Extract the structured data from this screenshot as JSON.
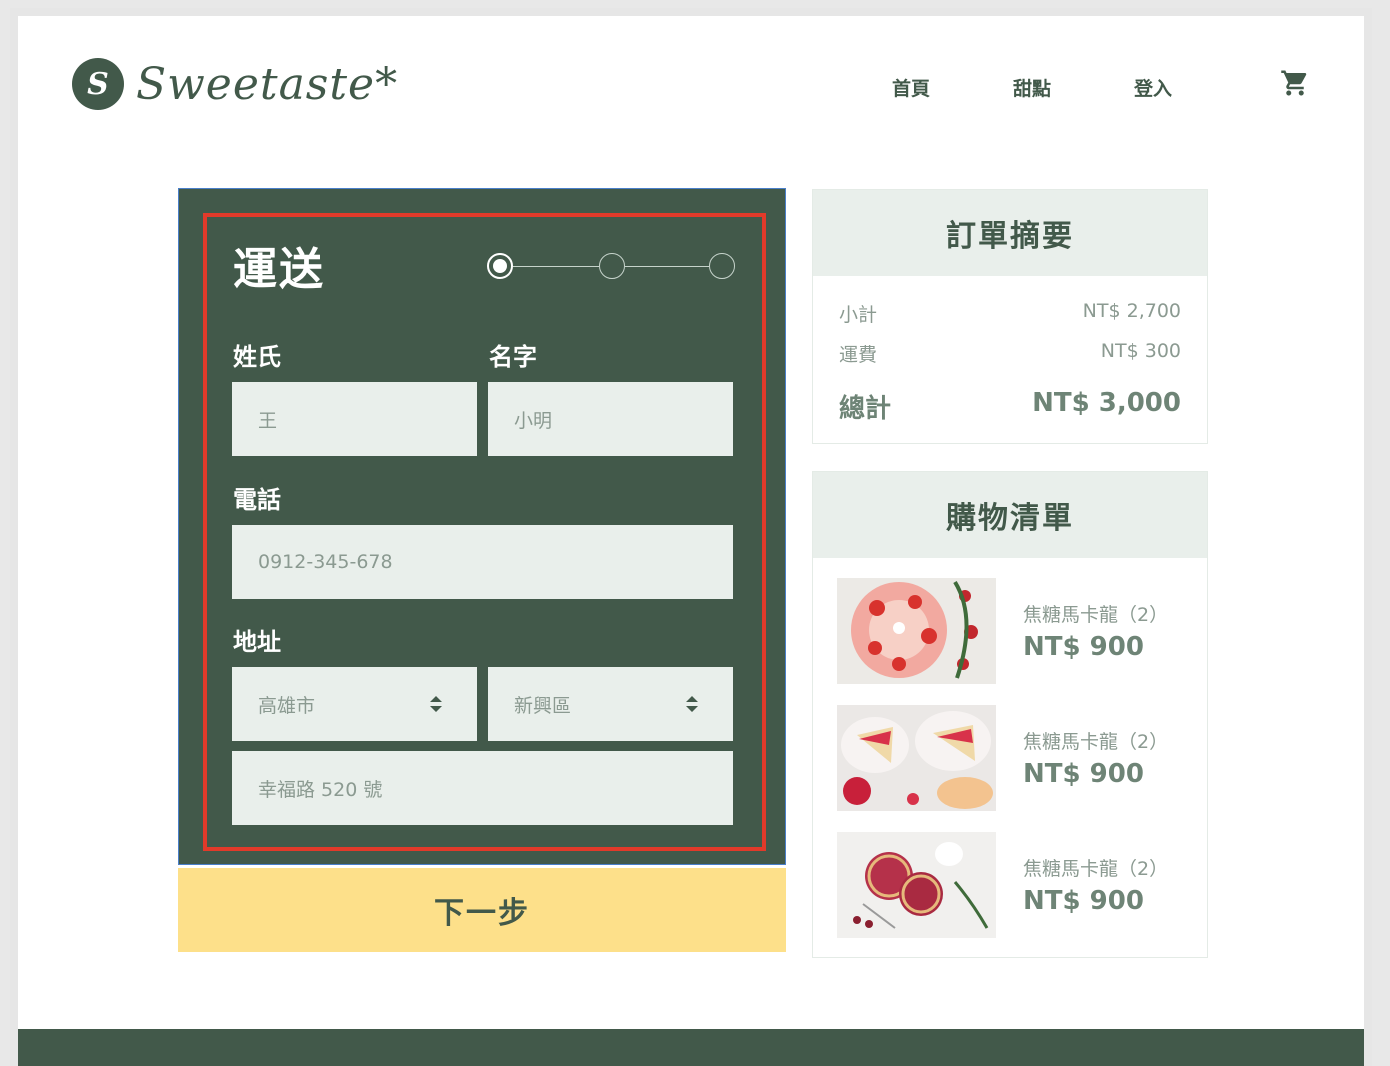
{
  "brand": {
    "logo_letter": "S",
    "name": "Sweetaste*"
  },
  "nav": {
    "items": [
      "首頁",
      "甜點",
      "登入"
    ],
    "cart_icon": "cart-icon"
  },
  "shipping": {
    "title": "運送",
    "steps": {
      "total": 3,
      "current": 1
    },
    "labels": {
      "last_name": "姓氏",
      "first_name": "名字",
      "phone": "電話",
      "address": "地址"
    },
    "values": {
      "last_name": "王",
      "first_name": "小明",
      "phone": "0912-345-678",
      "city": "高雄市",
      "district": "新興區",
      "street": "幸福路 520 號"
    },
    "next_label": "下一步"
  },
  "summary": {
    "title": "訂單摘要",
    "rows": [
      {
        "label": "小計",
        "value": "NT$ 2,700"
      },
      {
        "label": "運費",
        "value": "NT$ 300"
      }
    ],
    "total": {
      "label": "總計",
      "value": "NT$ 3,000"
    }
  },
  "cart": {
    "title": "購物清單",
    "items": [
      {
        "name": "焦糖馬卡龍（2）",
        "price": "NT$ 900"
      },
      {
        "name": "焦糖馬卡龍（2）",
        "price": "NT$ 900"
      },
      {
        "name": "焦糖馬卡龍（2）",
        "price": "NT$ 900"
      }
    ]
  },
  "colors": {
    "primary": "#42594a",
    "accent": "#fde08a",
    "light": "#e9efeb",
    "muted": "#8b9a91"
  }
}
